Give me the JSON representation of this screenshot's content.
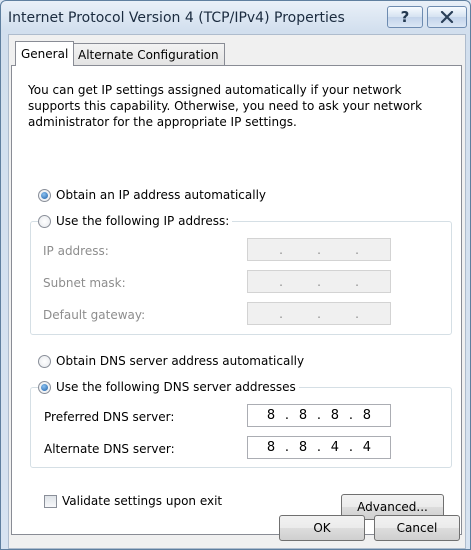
{
  "window": {
    "title": "Internet Protocol Version 4 (TCP/IPv4) Properties",
    "help_label": "?"
  },
  "tabs": [
    "General",
    "Alternate Configuration"
  ],
  "description": "You can get IP settings assigned automatically if your network supports this capability. Otherwise, you need to ask your network administrator for the appropriate IP settings.",
  "ip": {
    "auto_label": "Obtain an IP address automatically",
    "auto_selected": true,
    "manual_label": "Use the following IP address:",
    "fields": [
      {
        "label": "IP address:",
        "value": [
          ".",
          ".",
          "."
        ]
      },
      {
        "label": "Subnet mask:",
        "value": [
          ".",
          ".",
          "."
        ]
      },
      {
        "label": "Default gateway:",
        "value": [
          ".",
          ".",
          "."
        ]
      }
    ]
  },
  "dns": {
    "auto_label": "Obtain DNS server address automatically",
    "manual_label": "Use the following DNS server addresses",
    "manual_selected": true,
    "preferred_label": "Preferred DNS server:",
    "preferred_octets": [
      "8",
      ".",
      "8",
      ".",
      "8",
      ".",
      "8"
    ],
    "alternate_label": "Alternate DNS server:",
    "alternate_octets": [
      "8",
      ".",
      "8",
      ".",
      "4",
      ".",
      "4"
    ]
  },
  "validate_label": "Validate settings upon exit",
  "validate_checked": false,
  "buttons": {
    "advanced": "Advanced...",
    "ok": "OK",
    "cancel": "Cancel"
  }
}
